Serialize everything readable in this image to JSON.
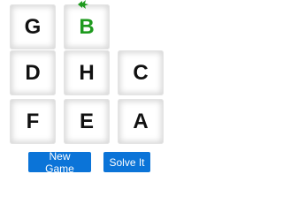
{
  "board": {
    "tiles": [
      {
        "letter": "G",
        "current": false
      },
      {
        "letter": "B",
        "current": true
      },
      {
        "letter": "D",
        "current": false
      },
      {
        "letter": "H",
        "current": false
      },
      {
        "letter": "C",
        "current": false
      },
      {
        "letter": "F",
        "current": false
      },
      {
        "letter": "E",
        "current": false
      },
      {
        "letter": "A",
        "current": false
      }
    ],
    "empty_slot": "top-right",
    "current_color": "#1e9a1e",
    "tile_text_color": "#111111"
  },
  "controls": {
    "new_game_label": "New Game",
    "solve_label": "Solve It",
    "button_color": "#0b74d8"
  }
}
